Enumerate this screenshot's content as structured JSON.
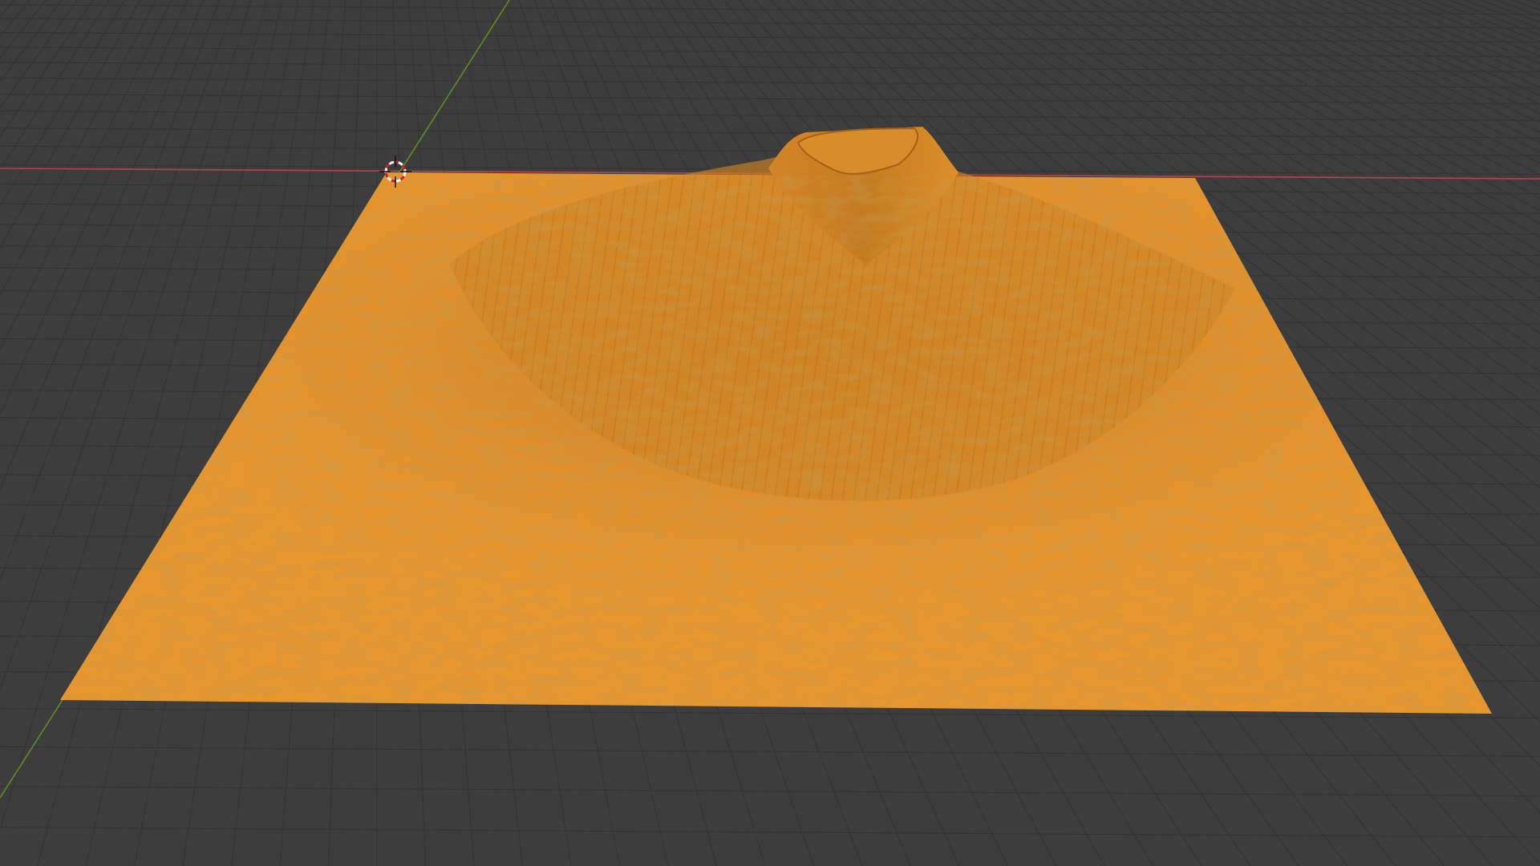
{
  "viewport": {
    "background_color": "#3d3d3d",
    "grid_color": "#333333",
    "x_axis_color": "#b5444a",
    "y_axis_color": "#5b8f1e"
  },
  "terrain": {
    "base_color": "#e8962e",
    "shadow_color": "#b76d1a",
    "highlight_color": "#f3ab45"
  },
  "cursor_3d": {
    "icon": "3d-cursor-icon",
    "ring_color_a": "#ffffff",
    "ring_color_b": "#d0202a"
  }
}
